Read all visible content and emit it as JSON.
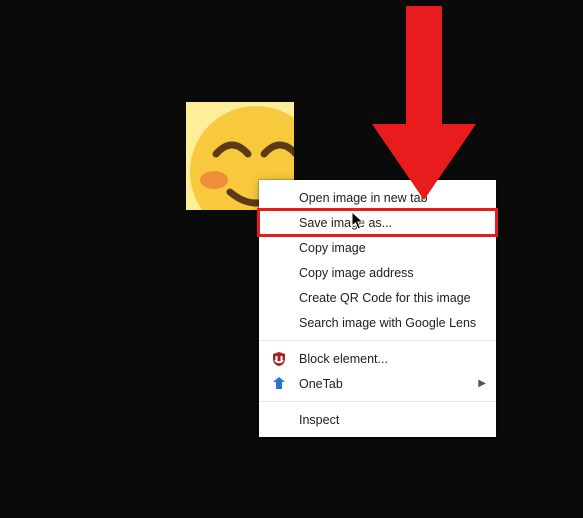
{
  "image": {
    "alt": "hugging face emoji"
  },
  "context_menu": {
    "items": [
      {
        "id": "open-new-tab",
        "label": "Open image in new tab",
        "highlighted": false,
        "icon": null,
        "submenu": false
      },
      {
        "id": "save-image-as",
        "label": "Save image as...",
        "highlighted": true,
        "icon": null,
        "submenu": false
      },
      {
        "id": "copy-image",
        "label": "Copy image",
        "highlighted": false,
        "icon": null,
        "submenu": false
      },
      {
        "id": "copy-image-address",
        "label": "Copy image address",
        "highlighted": false,
        "icon": null,
        "submenu": false
      },
      {
        "id": "create-qr",
        "label": "Create QR Code for this image",
        "highlighted": false,
        "icon": null,
        "submenu": false
      },
      {
        "id": "search-lens",
        "label": "Search image with Google Lens",
        "highlighted": false,
        "icon": null,
        "submenu": false
      },
      {
        "separator": true
      },
      {
        "id": "block-element",
        "label": "Block element...",
        "highlighted": false,
        "icon": "ublock-icon",
        "submenu": false
      },
      {
        "id": "onetab",
        "label": "OneTab",
        "highlighted": false,
        "icon": "onetab-icon",
        "submenu": true
      },
      {
        "separator": true
      },
      {
        "id": "inspect",
        "label": "Inspect",
        "highlighted": false,
        "icon": null,
        "submenu": false
      }
    ]
  },
  "annotation": {
    "arrow_color": "#e81c1c",
    "highlight_color": "#e81c1c"
  }
}
